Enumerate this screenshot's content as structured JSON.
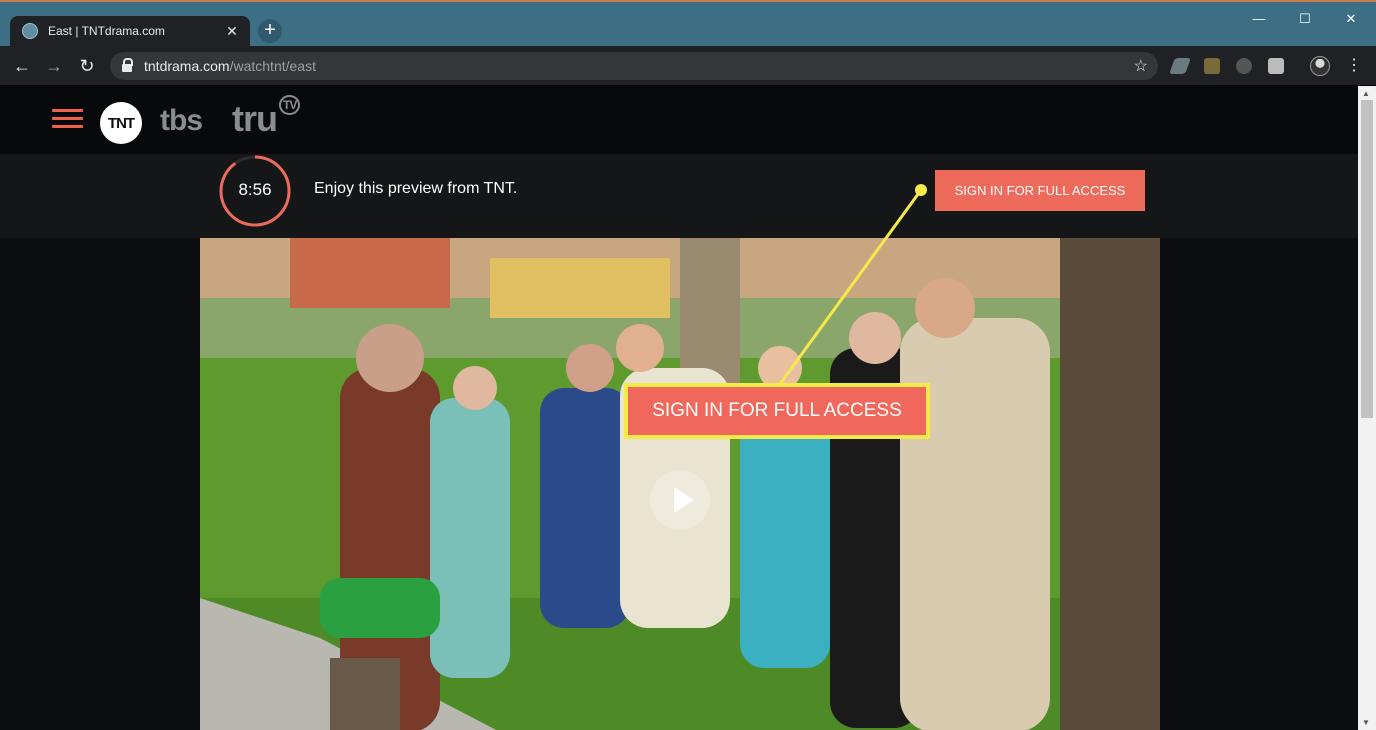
{
  "browser": {
    "tab": {
      "title": "East | TNTdrama.com",
      "close": "✕"
    },
    "new_tab": "+",
    "window_controls": {
      "minimize": "—",
      "maximize": "☐",
      "close": "✕"
    },
    "nav": {
      "back": "←",
      "forward": "→",
      "reload": "↻"
    },
    "address": {
      "host": "tntdrama.com",
      "path": "/watchtnt/east"
    },
    "star": "☆",
    "menu": "⋮"
  },
  "site": {
    "logos": {
      "tnt": "TNT",
      "tbs": "tbs",
      "trutv": "tru",
      "trutv_badge": "TV"
    },
    "preview": {
      "timer": "8:56",
      "text": "Enjoy this preview from TNT.",
      "signin_label": "SIGN IN FOR FULL ACCESS",
      "timer_remaining_fraction": 0.9
    }
  },
  "callout": {
    "label": "SIGN IN FOR FULL ACCESS"
  },
  "colors": {
    "accent": "#ee6a5a",
    "callout_border": "#f6e94a",
    "tabstrip": "#3c6e84"
  }
}
